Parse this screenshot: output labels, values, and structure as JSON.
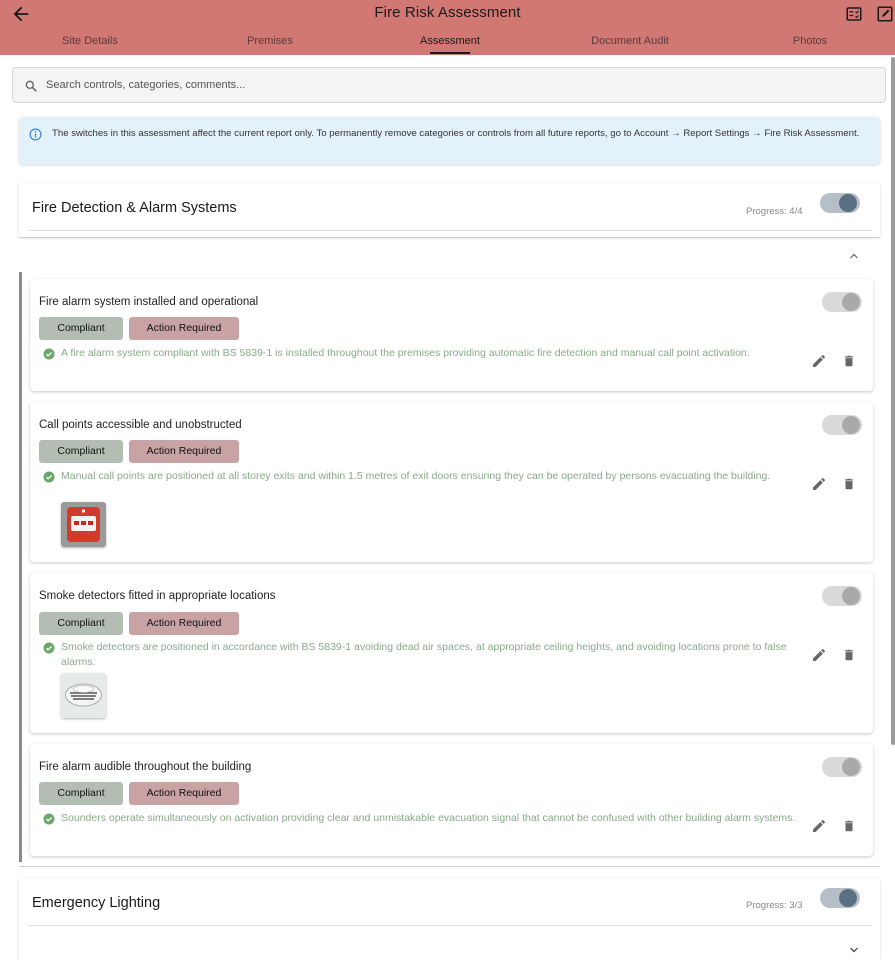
{
  "appbar": {
    "title": "Fire Risk Assessment",
    "color": "#d17874",
    "icons": [
      "back-arrow-icon",
      "checklist-icon",
      "edit-square-icon"
    ]
  },
  "tabs": [
    {
      "label": "Site Details",
      "active": false
    },
    {
      "label": "Premises",
      "active": false
    },
    {
      "label": "Assessment",
      "active": true
    },
    {
      "label": "Document Audit",
      "active": false
    },
    {
      "label": "Photos",
      "active": false
    }
  ],
  "search": {
    "placeholder": "Search controls, categories, comments..."
  },
  "info": {
    "text": "The switches in this assessment affect the current report only. To permanently remove categories or controls from all future reports, go to Account → Report Settings → Fire Risk Assessment."
  },
  "sections": [
    {
      "title": "Fire Detection & Alarm Systems",
      "progress": "Progress: 4/4",
      "enabled": true,
      "expanded": true,
      "controls": [
        {
          "title": "Fire alarm system installed and operational",
          "compliant_label": "Compliant",
          "action_label": "Action Required",
          "comment": "A fire alarm system compliant with BS 5839-1 is installed throughout the premises providing automatic fire detection and manual call point activation.",
          "enabled": false
        },
        {
          "title": "Call points accessible and unobstructed",
          "compliant_label": "Compliant",
          "action_label": "Action Required",
          "comment": "Manual call points are positioned at all storey exits and within 1.5 metres of exit doors ensuring they can be operated by persons evacuating the building.",
          "enabled": false,
          "photo": "call-point-photo"
        },
        {
          "title": "Smoke detectors fitted in appropriate locations",
          "compliant_label": "Compliant",
          "action_label": "Action Required",
          "comment": "Smoke detectors are positioned in accordance with BS 5839-1 avoiding dead air spaces, at appropriate ceiling heights, and avoiding locations prone to false alarms.",
          "enabled": false,
          "photo": "smoke-detector-photo"
        },
        {
          "title": "Fire alarm audible throughout the building",
          "compliant_label": "Compliant",
          "action_label": "Action Required",
          "comment": "Sounders operate simultaneously on activation providing clear and unmistakable evacuation signal that cannot be confused with other building alarm systems.",
          "enabled": false
        }
      ]
    },
    {
      "title": "Emergency Lighting",
      "progress": "Progress: 3/3",
      "enabled": true,
      "expanded": false
    }
  ],
  "colors": {
    "compliant": "#b4bdb4",
    "action_required": "#c9a2a4",
    "comment_text": "#8aa88a",
    "info_bg": "#e3f1fb"
  }
}
